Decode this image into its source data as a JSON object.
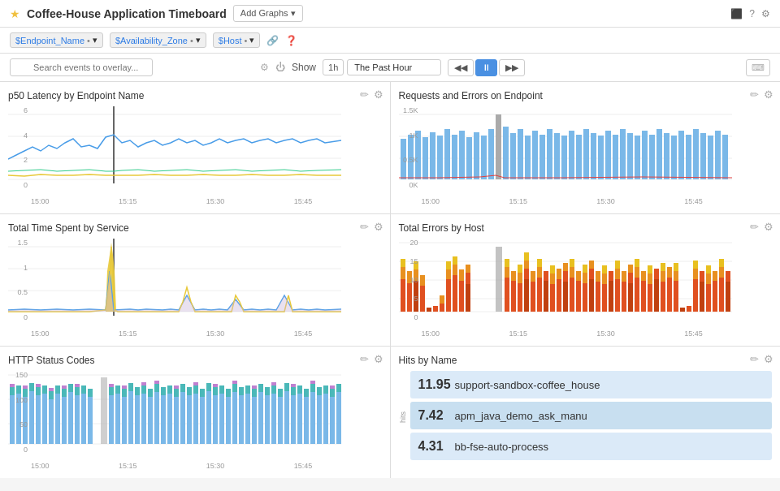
{
  "header": {
    "star": "★",
    "title": "Coffee-House Application Timeboard",
    "add_graphs": "Add Graphs ▾",
    "icons": [
      "monitor",
      "help",
      "gear"
    ]
  },
  "filters": [
    {
      "var": "$Endpoint_Name",
      "dot1": "•",
      "arrow": "▾"
    },
    {
      "var": "$Availability_Zone",
      "dot1": "•",
      "arrow": "▾"
    },
    {
      "var": "$Host",
      "dot1": "•",
      "arrow": "▾"
    }
  ],
  "search": {
    "placeholder": "Search events to overlay...",
    "show_label": "Show",
    "time_short": "1h",
    "time_full": "The Past Hour",
    "keyboard_hint": "⌨"
  },
  "charts": [
    {
      "id": "p50-latency",
      "title": "p50 Latency by Endpoint Name",
      "y_labels": [
        "6",
        "4",
        "2",
        "0"
      ],
      "x_labels": [
        "15:00",
        "15:15",
        "15:30",
        "15:45",
        ""
      ]
    },
    {
      "id": "requests-errors",
      "title": "Requests and Errors on Endpoint",
      "y_labels": [
        "1.5K",
        "1K",
        "0.5K",
        "0K"
      ],
      "x_labels": [
        "15:00",
        "15:15",
        "15:30",
        "15:45",
        ""
      ]
    },
    {
      "id": "total-time",
      "title": "Total Time Spent by Service",
      "y_labels": [
        "1.5",
        "1",
        "0.5",
        "0"
      ],
      "x_labels": [
        "15:00",
        "15:15",
        "15:30",
        "15:45",
        ""
      ]
    },
    {
      "id": "total-errors",
      "title": "Total Errors by Host",
      "y_labels": [
        "20",
        "15",
        "10",
        "5",
        "0"
      ],
      "x_labels": [
        "15:00",
        "15:15",
        "15:30",
        "15:45",
        ""
      ]
    },
    {
      "id": "http-status",
      "title": "HTTP Status Codes",
      "y_labels": [
        "150",
        "100",
        "50",
        "0"
      ],
      "x_labels": [
        "15:00",
        "15:15",
        "15:30",
        "15:45",
        ""
      ]
    }
  ],
  "hits": {
    "title": "Hits by Name",
    "y_label": "hits",
    "rows": [
      {
        "value": "11.95",
        "name": "support-sandbox-coffee_house"
      },
      {
        "value": "7.42",
        "name": "apm_java_demo_ask_manu"
      },
      {
        "value": "4.31",
        "name": "bb-fse-auto-process"
      }
    ]
  }
}
